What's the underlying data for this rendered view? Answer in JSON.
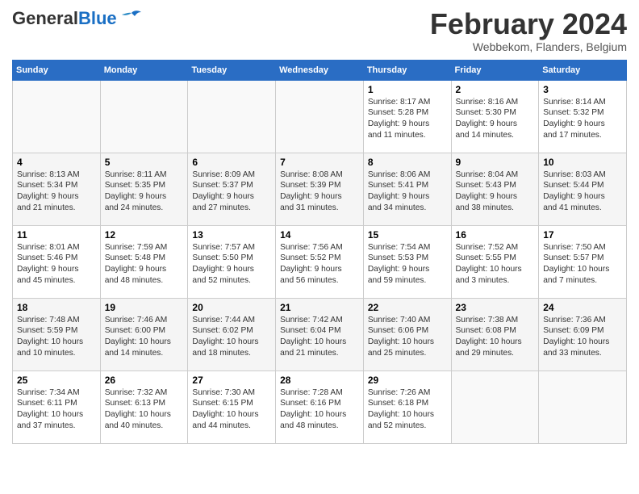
{
  "header": {
    "logo_general": "General",
    "logo_blue": "Blue",
    "title": "February 2024",
    "subtitle": "Webbekom, Flanders, Belgium"
  },
  "weekdays": [
    "Sunday",
    "Monday",
    "Tuesday",
    "Wednesday",
    "Thursday",
    "Friday",
    "Saturday"
  ],
  "weeks": [
    [
      {
        "day": "",
        "info": ""
      },
      {
        "day": "",
        "info": ""
      },
      {
        "day": "",
        "info": ""
      },
      {
        "day": "",
        "info": ""
      },
      {
        "day": "1",
        "info": "Sunrise: 8:17 AM\nSunset: 5:28 PM\nDaylight: 9 hours\nand 11 minutes."
      },
      {
        "day": "2",
        "info": "Sunrise: 8:16 AM\nSunset: 5:30 PM\nDaylight: 9 hours\nand 14 minutes."
      },
      {
        "day": "3",
        "info": "Sunrise: 8:14 AM\nSunset: 5:32 PM\nDaylight: 9 hours\nand 17 minutes."
      }
    ],
    [
      {
        "day": "4",
        "info": "Sunrise: 8:13 AM\nSunset: 5:34 PM\nDaylight: 9 hours\nand 21 minutes."
      },
      {
        "day": "5",
        "info": "Sunrise: 8:11 AM\nSunset: 5:35 PM\nDaylight: 9 hours\nand 24 minutes."
      },
      {
        "day": "6",
        "info": "Sunrise: 8:09 AM\nSunset: 5:37 PM\nDaylight: 9 hours\nand 27 minutes."
      },
      {
        "day": "7",
        "info": "Sunrise: 8:08 AM\nSunset: 5:39 PM\nDaylight: 9 hours\nand 31 minutes."
      },
      {
        "day": "8",
        "info": "Sunrise: 8:06 AM\nSunset: 5:41 PM\nDaylight: 9 hours\nand 34 minutes."
      },
      {
        "day": "9",
        "info": "Sunrise: 8:04 AM\nSunset: 5:43 PM\nDaylight: 9 hours\nand 38 minutes."
      },
      {
        "day": "10",
        "info": "Sunrise: 8:03 AM\nSunset: 5:44 PM\nDaylight: 9 hours\nand 41 minutes."
      }
    ],
    [
      {
        "day": "11",
        "info": "Sunrise: 8:01 AM\nSunset: 5:46 PM\nDaylight: 9 hours\nand 45 minutes."
      },
      {
        "day": "12",
        "info": "Sunrise: 7:59 AM\nSunset: 5:48 PM\nDaylight: 9 hours\nand 48 minutes."
      },
      {
        "day": "13",
        "info": "Sunrise: 7:57 AM\nSunset: 5:50 PM\nDaylight: 9 hours\nand 52 minutes."
      },
      {
        "day": "14",
        "info": "Sunrise: 7:56 AM\nSunset: 5:52 PM\nDaylight: 9 hours\nand 56 minutes."
      },
      {
        "day": "15",
        "info": "Sunrise: 7:54 AM\nSunset: 5:53 PM\nDaylight: 9 hours\nand 59 minutes."
      },
      {
        "day": "16",
        "info": "Sunrise: 7:52 AM\nSunset: 5:55 PM\nDaylight: 10 hours\nand 3 minutes."
      },
      {
        "day": "17",
        "info": "Sunrise: 7:50 AM\nSunset: 5:57 PM\nDaylight: 10 hours\nand 7 minutes."
      }
    ],
    [
      {
        "day": "18",
        "info": "Sunrise: 7:48 AM\nSunset: 5:59 PM\nDaylight: 10 hours\nand 10 minutes."
      },
      {
        "day": "19",
        "info": "Sunrise: 7:46 AM\nSunset: 6:00 PM\nDaylight: 10 hours\nand 14 minutes."
      },
      {
        "day": "20",
        "info": "Sunrise: 7:44 AM\nSunset: 6:02 PM\nDaylight: 10 hours\nand 18 minutes."
      },
      {
        "day": "21",
        "info": "Sunrise: 7:42 AM\nSunset: 6:04 PM\nDaylight: 10 hours\nand 21 minutes."
      },
      {
        "day": "22",
        "info": "Sunrise: 7:40 AM\nSunset: 6:06 PM\nDaylight: 10 hours\nand 25 minutes."
      },
      {
        "day": "23",
        "info": "Sunrise: 7:38 AM\nSunset: 6:08 PM\nDaylight: 10 hours\nand 29 minutes."
      },
      {
        "day": "24",
        "info": "Sunrise: 7:36 AM\nSunset: 6:09 PM\nDaylight: 10 hours\nand 33 minutes."
      }
    ],
    [
      {
        "day": "25",
        "info": "Sunrise: 7:34 AM\nSunset: 6:11 PM\nDaylight: 10 hours\nand 37 minutes."
      },
      {
        "day": "26",
        "info": "Sunrise: 7:32 AM\nSunset: 6:13 PM\nDaylight: 10 hours\nand 40 minutes."
      },
      {
        "day": "27",
        "info": "Sunrise: 7:30 AM\nSunset: 6:15 PM\nDaylight: 10 hours\nand 44 minutes."
      },
      {
        "day": "28",
        "info": "Sunrise: 7:28 AM\nSunset: 6:16 PM\nDaylight: 10 hours\nand 48 minutes."
      },
      {
        "day": "29",
        "info": "Sunrise: 7:26 AM\nSunset: 6:18 PM\nDaylight: 10 hours\nand 52 minutes."
      },
      {
        "day": "",
        "info": ""
      },
      {
        "day": "",
        "info": ""
      }
    ]
  ]
}
